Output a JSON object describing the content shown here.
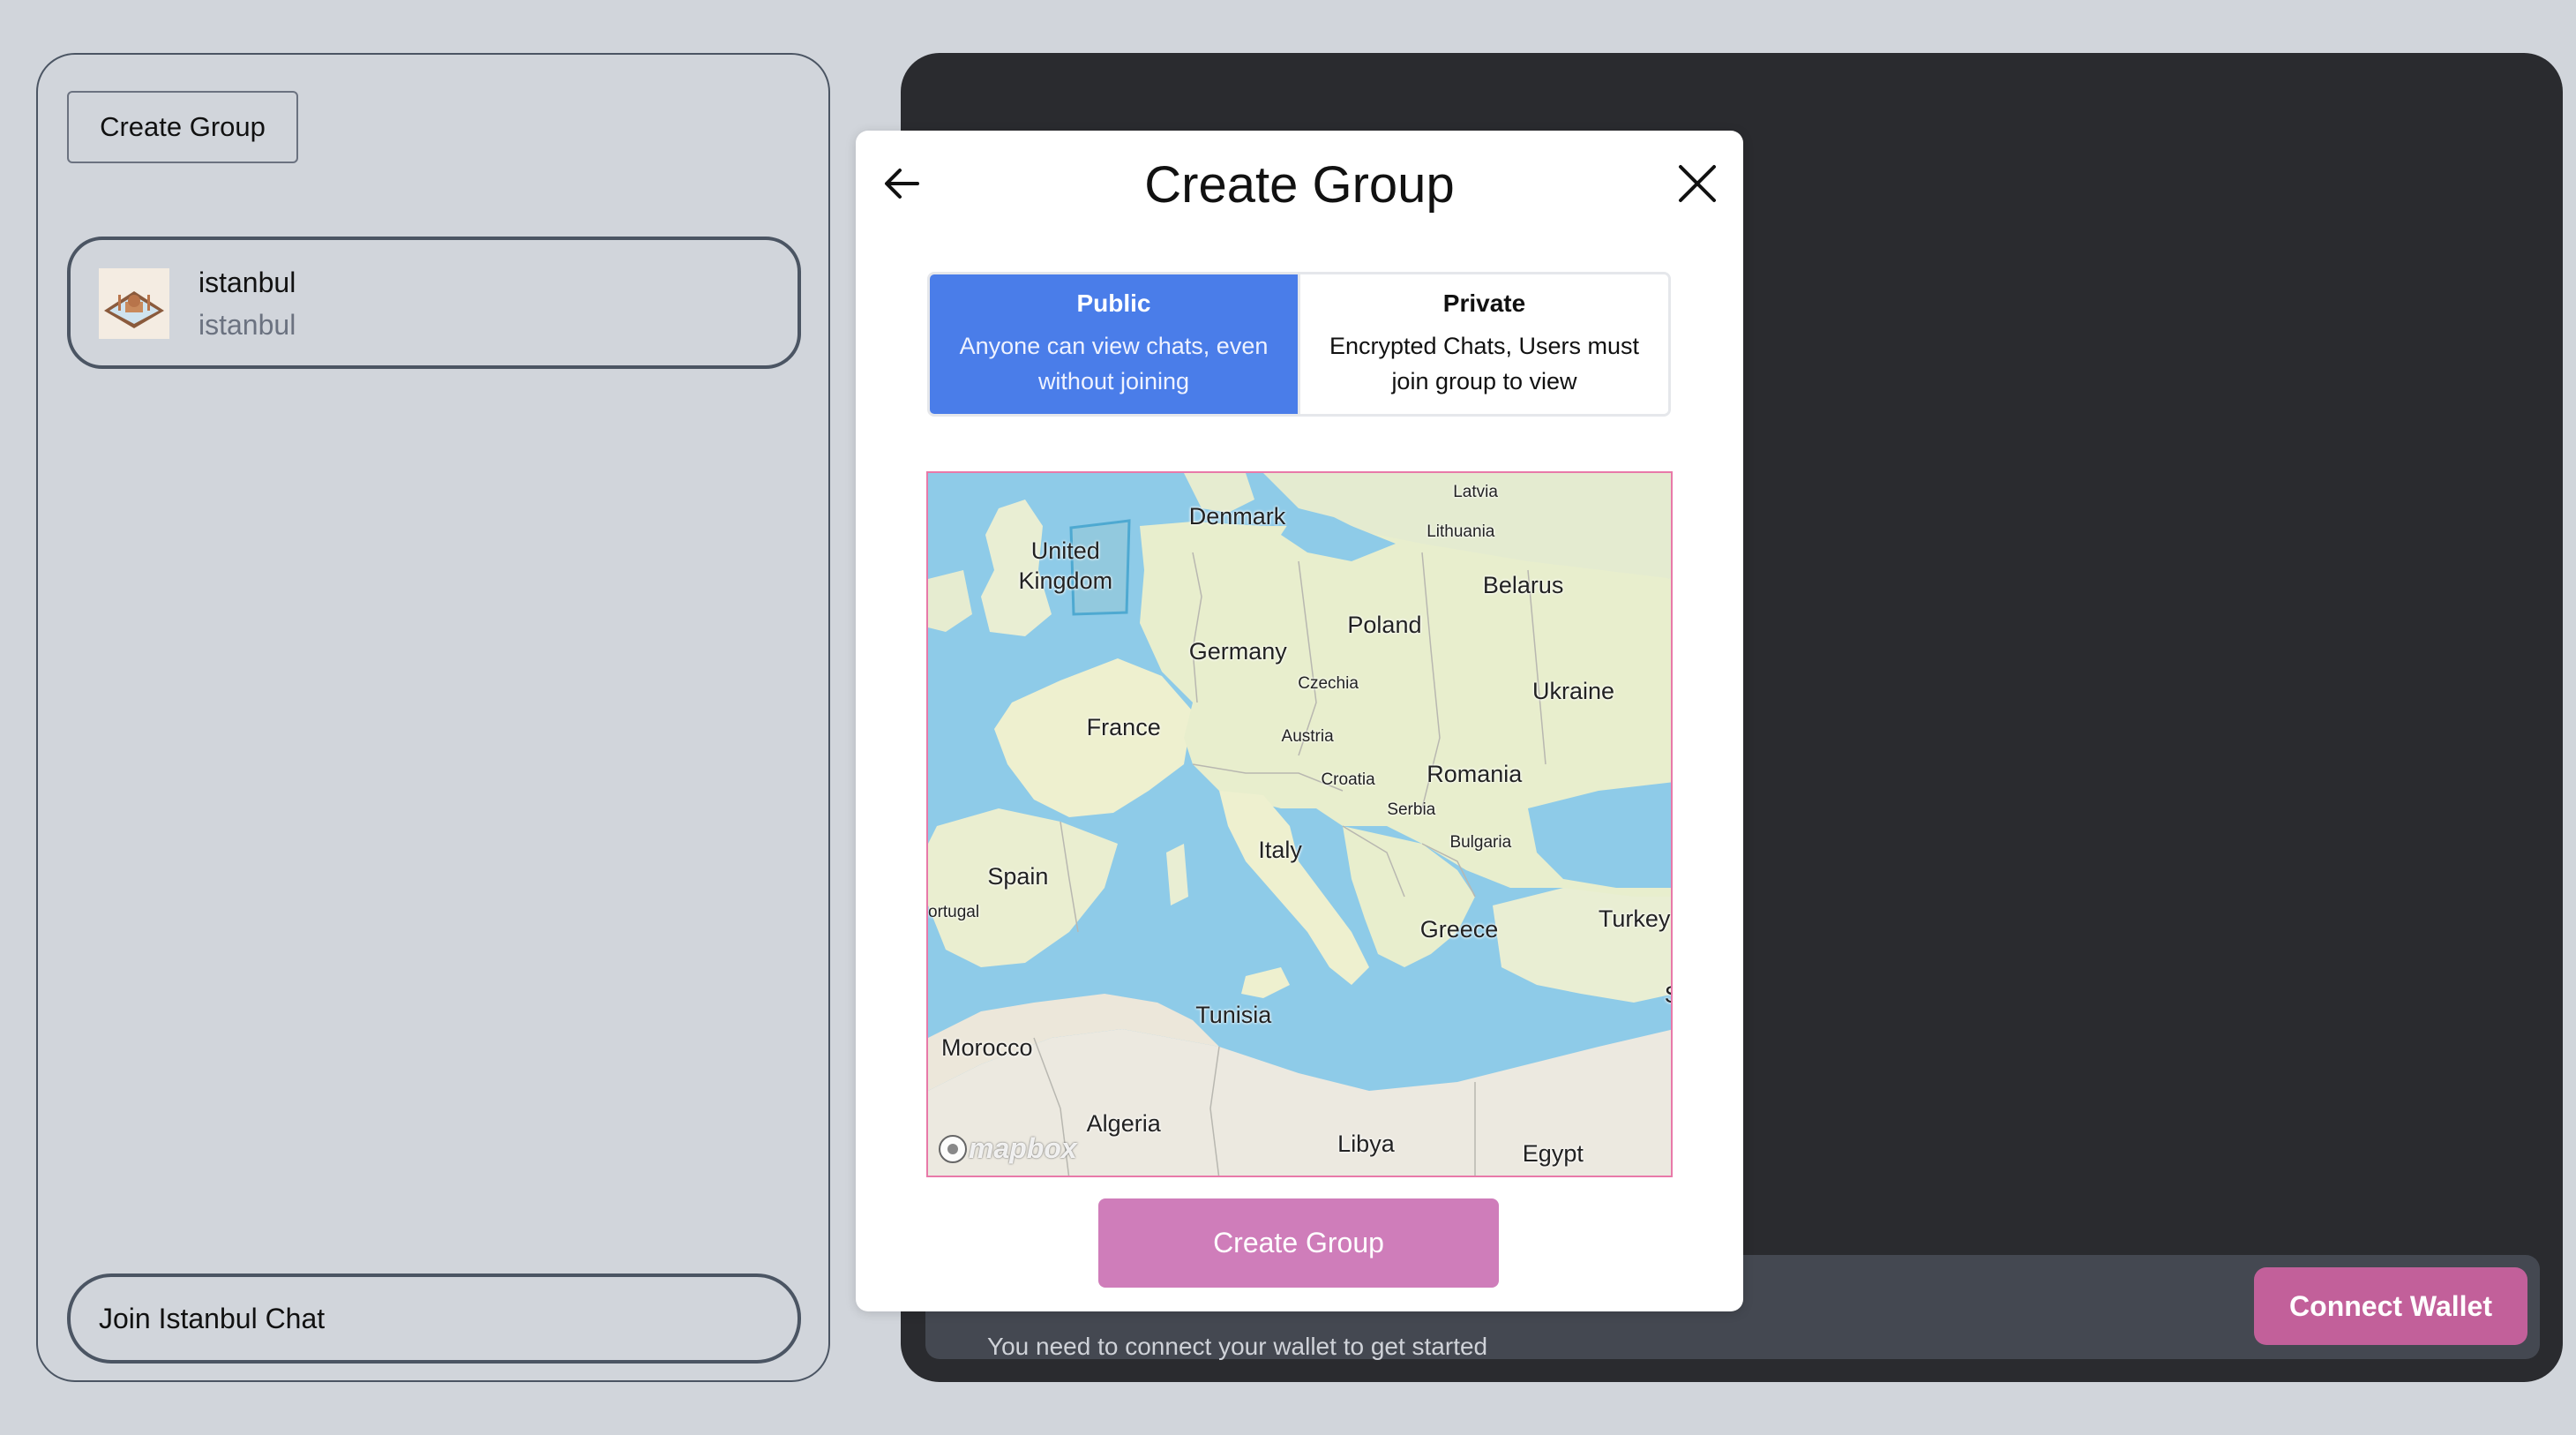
{
  "sidebar": {
    "create_group_label": "Create Group",
    "groups": [
      {
        "name": "istanbul",
        "subtitle": "istanbul"
      }
    ],
    "join_label": "Join Istanbul Chat"
  },
  "chat": {
    "hint": "You need to connect your wallet to get started",
    "connect_wallet_label": "Connect Wallet"
  },
  "modal": {
    "title": "Create Group",
    "public_title": "Public",
    "public_desc": "Anyone can view chats, even without joining",
    "private_title": "Private",
    "private_desc": "Encrypted Chats, Users must join group to view",
    "selected_option": "Public",
    "submit_label": "Create Group",
    "map": {
      "attribution": "mapbox",
      "selected_region": "Germany",
      "labels": {
        "denmark": "Denmark",
        "latvia": "Latvia",
        "lithuania": "Lithuania",
        "uk": "United Kingdom",
        "belarus": "Belarus",
        "poland": "Poland",
        "germany": "Germany",
        "czechia": "Czechia",
        "ukraine": "Ukraine",
        "france": "France",
        "austria": "Austria",
        "croatia": "Croatia",
        "romania": "Romania",
        "serbia": "Serbia",
        "bulgaria": "Bulgaria",
        "italy": "Italy",
        "spain": "Spain",
        "portugal": "ortugal",
        "turkey": "Turkey",
        "greece": "Greece",
        "tunisia": "Tunisia",
        "morocco": "Morocco",
        "algeria": "Algeria",
        "libya": "Libya",
        "egypt": "Egypt",
        "syria": "S"
      }
    }
  },
  "colors": {
    "accent_public": "#4a7de9",
    "button_pink": "#cf7dba",
    "wallet_button": "#c2609a",
    "dark_panel": "#2a2b2f"
  }
}
